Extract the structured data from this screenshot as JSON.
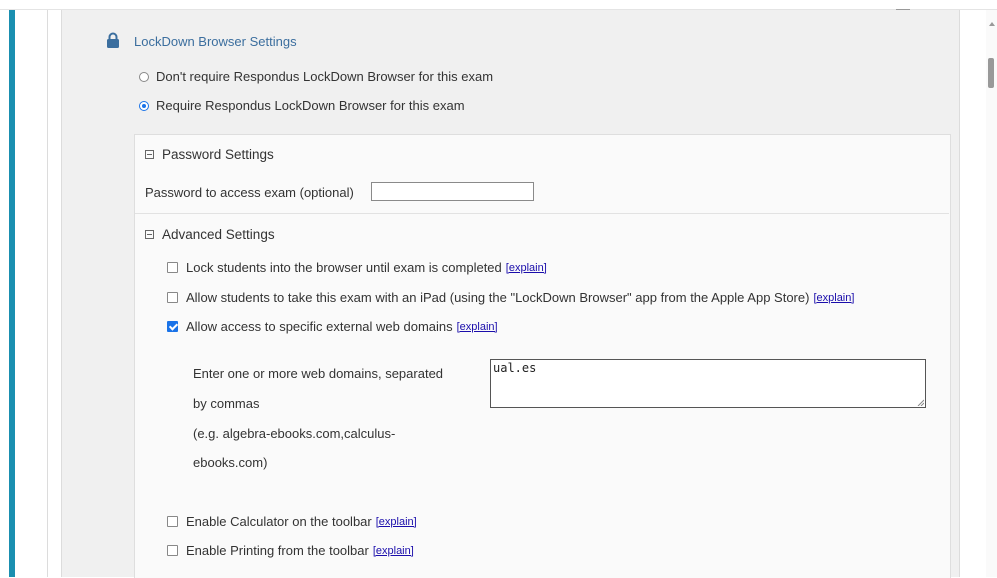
{
  "lockdown": {
    "title": "LockDown Browser Settings",
    "options": [
      {
        "label": "Don't require Respondus LockDown Browser for this exam",
        "selected": false
      },
      {
        "label": "Require Respondus LockDown Browser for this exam",
        "selected": true
      }
    ]
  },
  "password": {
    "heading": "Password Settings",
    "label": "Password to access exam (optional)",
    "value": ""
  },
  "advanced": {
    "heading": "Advanced Settings",
    "explain_label": "[explain]",
    "options": [
      {
        "label": "Lock students into the browser until exam is completed",
        "checked": false
      },
      {
        "label": "Allow students to take this exam with an iPad (using the \"LockDown Browser\" app from the Apple App Store)",
        "checked": false
      },
      {
        "label": "Allow access to specific external web domains",
        "checked": true
      }
    ],
    "domains": {
      "help_lines": [
        "Enter one or more web domains, separated",
        "by commas",
        "(e.g. algebra-ebooks.com,calculus-",
        "ebooks.com)"
      ],
      "value": "ual.es"
    },
    "toolbar_options": [
      {
        "label": "Enable Calculator on the toolbar",
        "checked": false
      },
      {
        "label": "Enable Printing from the toolbar",
        "checked": false
      }
    ]
  },
  "colors": {
    "accent_bar": "#1a8fb0",
    "link": "#1a0dab",
    "title": "#3b6e9e",
    "checkbox": "#1a73e8"
  },
  "icons": [
    "lock-icon",
    "collapse-icon",
    "radio-icon",
    "checkbox-icon"
  ]
}
